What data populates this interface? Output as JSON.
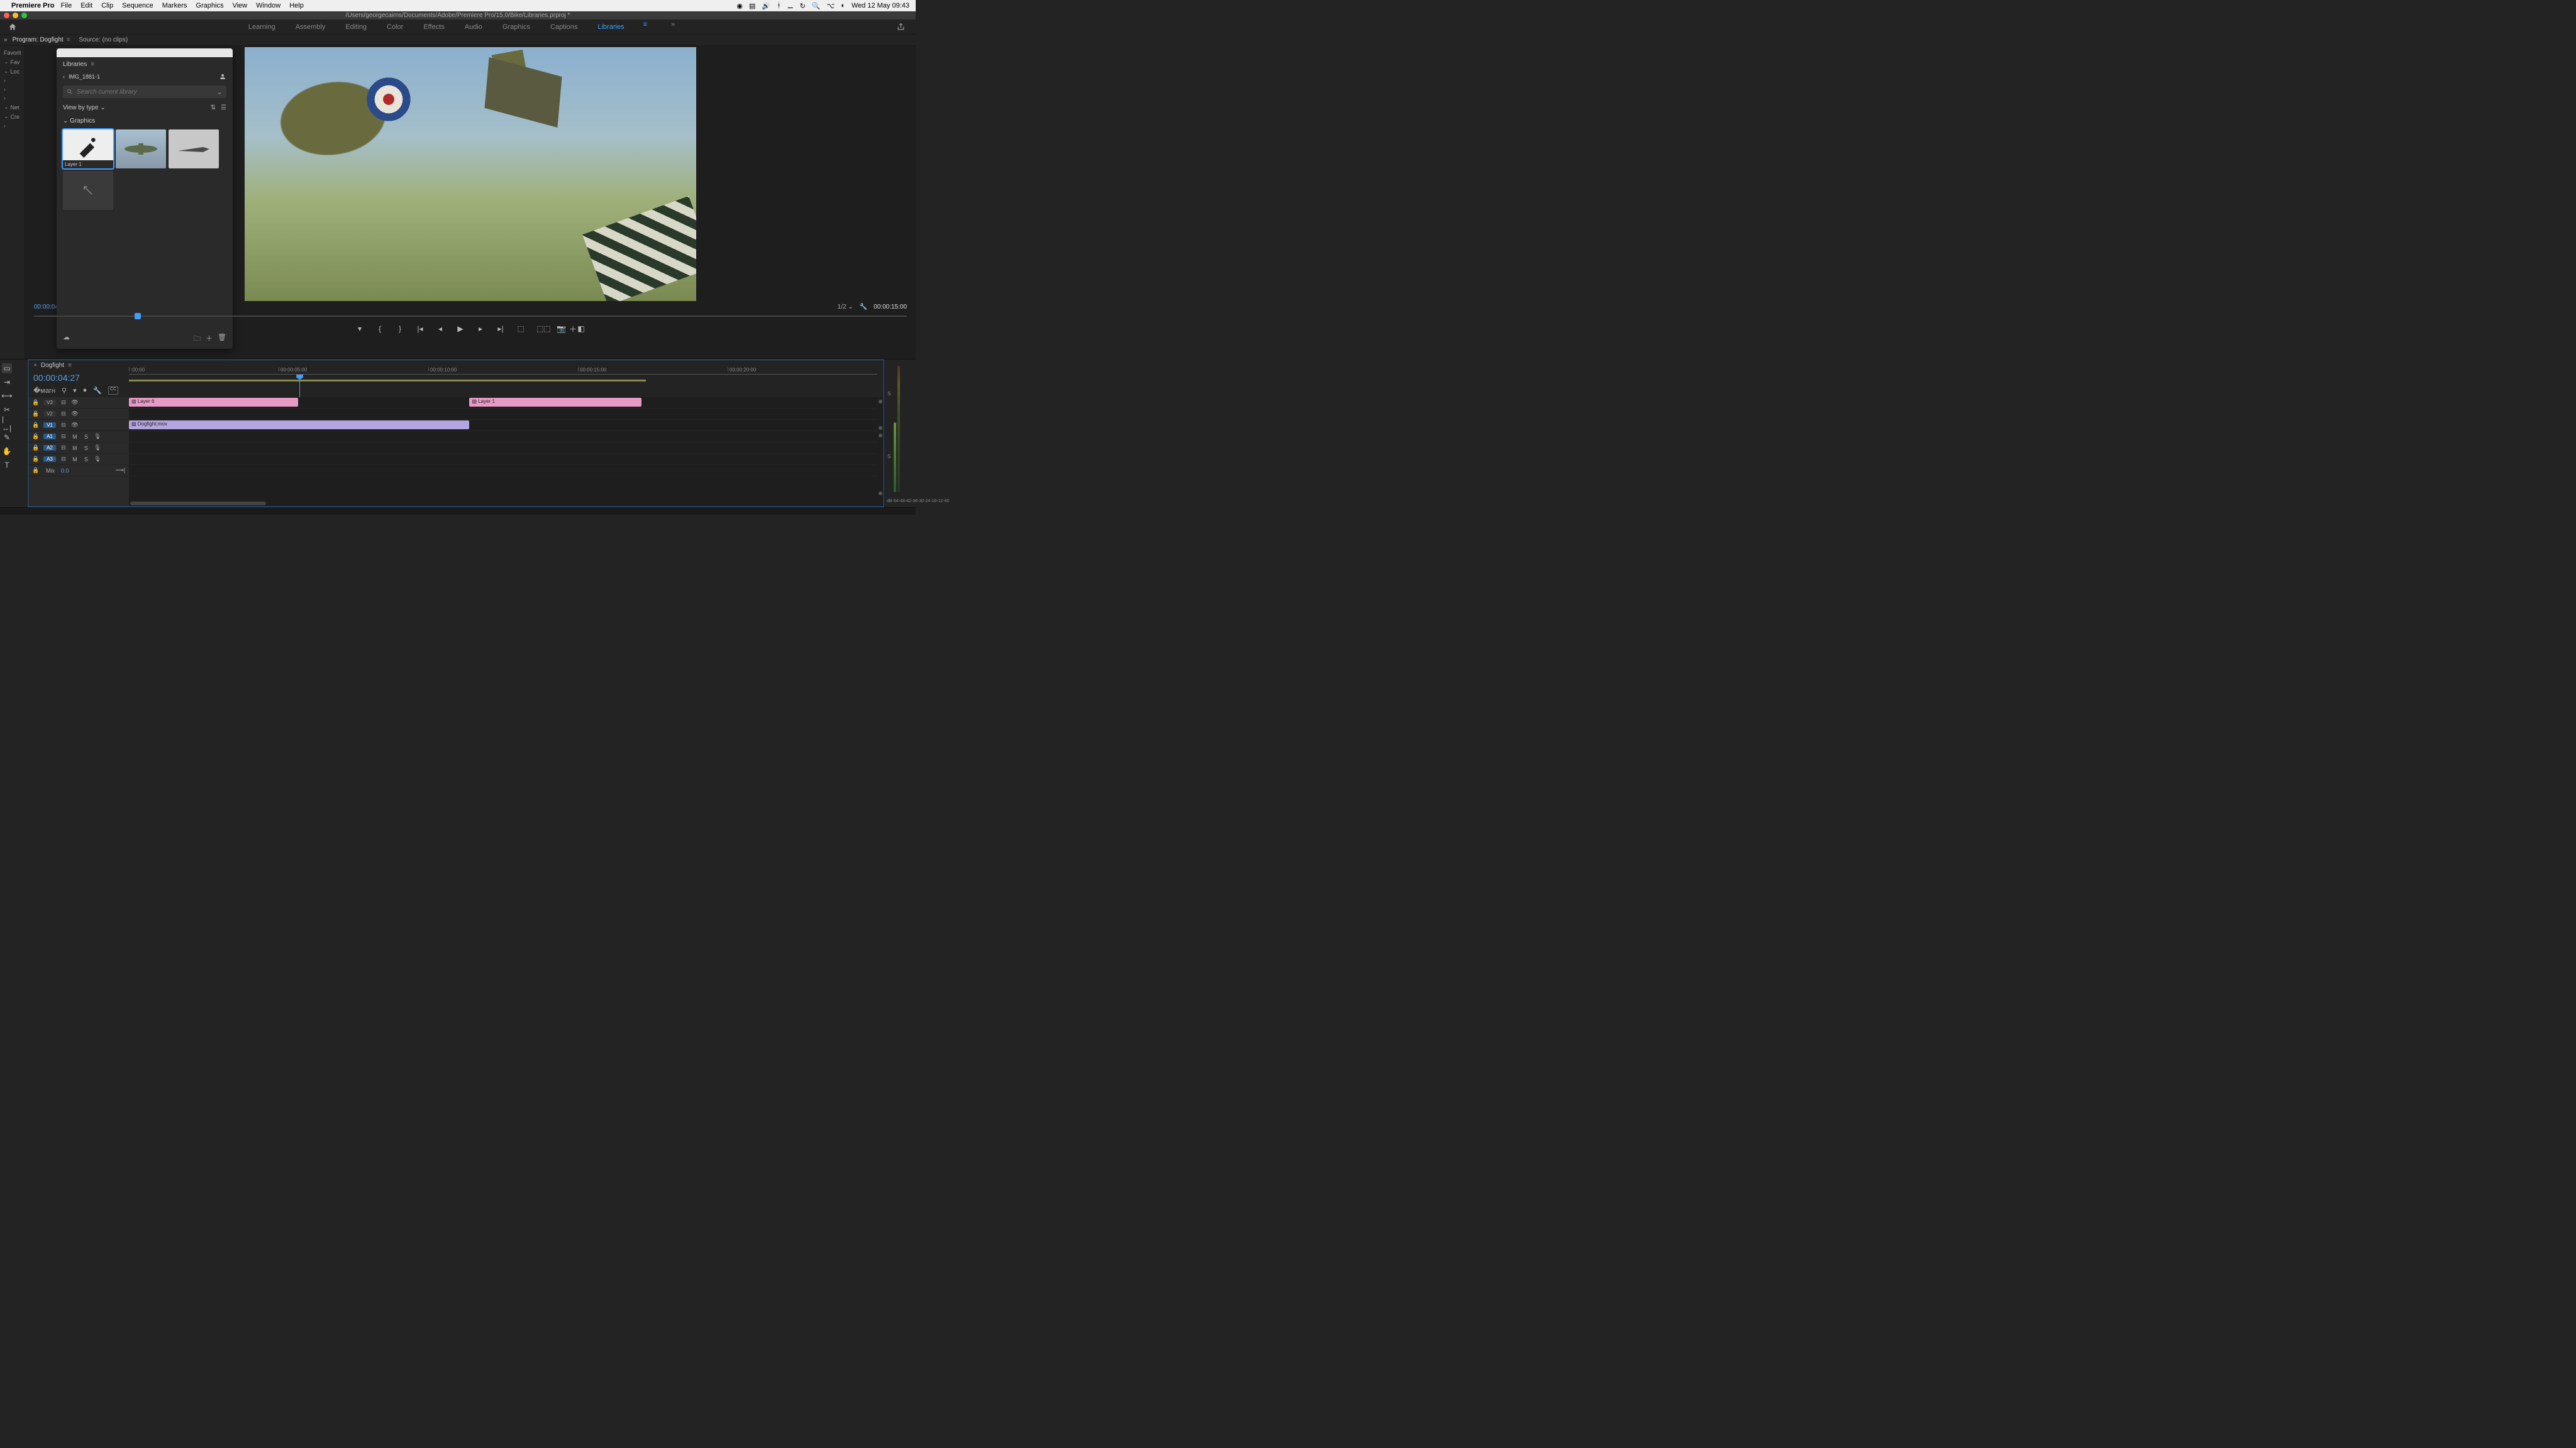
{
  "mac_menu": {
    "app": "Premiere Pro",
    "items": [
      "File",
      "Edit",
      "Clip",
      "Sequence",
      "Markers",
      "Graphics",
      "View",
      "Window",
      "Help"
    ],
    "clock": "Wed 12 May  09:43"
  },
  "titlebar": {
    "path": "/Users/georgecairns/Documents/Adobe/Premiere Pro/15.0/Bike/Libraries.prproj *"
  },
  "workspaces": {
    "items": [
      "Learning",
      "Assembly",
      "Editing",
      "Color",
      "Effects",
      "Audio",
      "Graphics",
      "Captions",
      "Libraries"
    ],
    "active": "Libraries"
  },
  "panel_tabs": {
    "program": "Program: Dogfight",
    "source": "Source: (no clips)"
  },
  "left_strip": {
    "header": "Favorit",
    "items": [
      "Fav",
      "Loc",
      "",
      "",
      "",
      "Net",
      "Cre",
      ""
    ]
  },
  "libraries": {
    "title": "Libraries",
    "breadcrumb": "IMG_1881-1",
    "search_placeholder": "Search current library",
    "view_by": "View by type",
    "section": "Graphics",
    "thumbs": [
      {
        "label": "Layer 1",
        "selected": true
      },
      {
        "label": ""
      },
      {
        "label": ""
      }
    ]
  },
  "program": {
    "tc_left": "00:00:04",
    "zoom": "1/2",
    "tc_right": "00:00:15:00"
  },
  "timeline": {
    "sequence_name": "Dogfight",
    "tc": "00:00:04:27",
    "ruler": [
      ":00:00",
      "00:00:05:00",
      "00:00:10:00",
      "00:00:15:00",
      "00:00:20:00"
    ],
    "video_tracks": [
      "V3",
      "V2",
      "V1"
    ],
    "audio_tracks": [
      "A1",
      "A2",
      "A3"
    ],
    "mix_label": "Mix",
    "mix_value": "0.0",
    "clips": {
      "v3_a": "Layer 6",
      "v3_b": "Layer 1",
      "v1": "Dogfight.mov"
    }
  },
  "meter": {
    "scale": [
      "dB",
      "-54",
      "-48",
      "-42",
      "-36",
      "-30",
      "-24",
      "-18",
      "-12",
      "-6",
      "0"
    ]
  }
}
